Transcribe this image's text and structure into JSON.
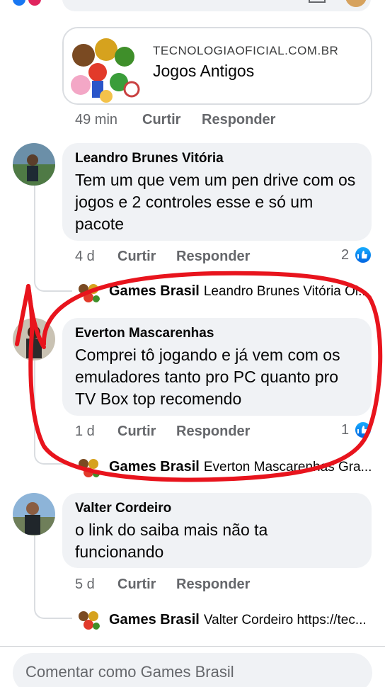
{
  "link_preview": {
    "domain": "TECNOLOGIAOFICIAL.COM.BR",
    "title": "Jogos Antigos"
  },
  "post_meta": {
    "time": "49 min",
    "like": "Curtir",
    "reply": "Responder"
  },
  "comments": [
    {
      "author": "Leandro Brunes Vitória",
      "text": "Tem um que vem um pen drive com os jogos e 2 controles esse e só um pacote",
      "time": "4 d",
      "like": "Curtir",
      "reply": "Responder",
      "likes": "2",
      "reply_preview": {
        "author": "Games Brasil",
        "text": "Leandro Brunes Vitória Ol..."
      }
    },
    {
      "author": "Everton Mascarenhas",
      "text": "Comprei  tô jogando e já vem com os emuladores tanto pro PC quanto pro TV Box  top recomendo",
      "time": "1 d",
      "like": "Curtir",
      "reply": "Responder",
      "likes": "1",
      "reply_preview": {
        "author": "Games Brasil",
        "text": "Everton Mascarenhas Gra..."
      }
    },
    {
      "author": "Valter Cordeiro",
      "text": "o link do saiba mais não ta funcionando",
      "time": "5 d",
      "like": "Curtir",
      "reply": "Responder",
      "reply_preview": {
        "author": "Games Brasil",
        "text": "Valter Cordeiro https://tec..."
      }
    }
  ],
  "composer": {
    "placeholder": "Comentar como Games Brasil"
  },
  "colors": {
    "like_blue": "#1877f2",
    "annotation_red": "#e8141d",
    "bubble": "#f0f2f5"
  },
  "icons": {
    "like": "thumbs-up-icon"
  }
}
